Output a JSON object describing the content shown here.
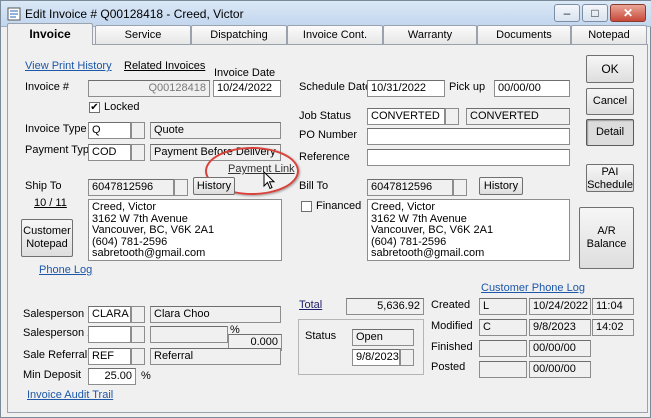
{
  "window": {
    "title": "Edit Invoice # Q00128418  -  Creed, Victor",
    "minimize_glyph": "–",
    "maximize_glyph": "□",
    "close_glyph": "✕"
  },
  "tabs": [
    {
      "label": "Invoice",
      "active": true
    },
    {
      "label": "Service"
    },
    {
      "label": "Dispatching"
    },
    {
      "label": "Invoice Cont."
    },
    {
      "label": "Warranty"
    },
    {
      "label": "Documents"
    },
    {
      "label": "Notepad"
    }
  ],
  "links": {
    "view_print_history": "View Print History",
    "related_invoices": "Related Invoices",
    "payment_link": "Payment Link",
    "phone_log": "Phone Log",
    "customer_phone_log": "Customer Phone Log",
    "invoice_audit_trail": "Invoice Audit Trail",
    "total": "Total"
  },
  "invoice": {
    "number_label": "Invoice #",
    "number": "Q00128418",
    "date_label": "Invoice Date",
    "date": "10/24/2022",
    "locked_label": "Locked",
    "locked": true,
    "type_label": "Invoice Type",
    "type_code": "Q",
    "type_desc": "Quote",
    "payment_type_label": "Payment Type",
    "payment_code": "COD",
    "payment_desc": "Payment Before Delivery"
  },
  "schedule": {
    "schedule_date_label": "Schedule Date",
    "schedule_date": "10/31/2022",
    "pickup_label": "Pick up",
    "pickup": "00/00/00",
    "job_status_label": "Job Status",
    "job_status": "CONVERTED",
    "job_status_desc": "CONVERTED",
    "po_label": "PO Number",
    "po_value": "",
    "reference_label": "Reference",
    "reference_value": ""
  },
  "ship_to": {
    "label": "Ship To",
    "phone": "6047812596",
    "history_button": "History",
    "count": "10 / 11",
    "address": [
      "Creed, Victor",
      "3162 W 7th Avenue",
      "Vancouver, BC, V6K 2A1",
      "(604) 781-2596",
      "sabretooth@gmail.com"
    ]
  },
  "bill_to": {
    "label": "Bill To",
    "phone": "6047812596",
    "history_button": "History",
    "financed_label": "Financed",
    "financed": false,
    "address": [
      "Creed, Victor",
      "3162 W 7th Avenue",
      "Vancouver, BC, V6K 2A1",
      "(604) 781-2596",
      "sabretooth@gmail.com"
    ]
  },
  "buttons": {
    "ok": "OK",
    "cancel": "Cancel",
    "detail": "Detail",
    "pai_schedule": "PAI\nSchedule",
    "ar_balance": "A/R\nBalance",
    "customer_notepad": "Customer\nNotepad"
  },
  "sales": {
    "salesperson1_label": "Salesperson 1",
    "salesperson1_code": "CLARA",
    "salesperson1_name": "Clara Choo",
    "salesperson2_label": "Salesperson 2",
    "salesperson2_code": "",
    "salesperson2_name": "",
    "percent_sign": "%",
    "percent_value": "0.000",
    "sale_referral_label": "Sale Referral",
    "sale_referral_code": "REF",
    "sale_referral_desc": "Referral",
    "min_deposit_label": "Min Deposit",
    "min_deposit": "25.00",
    "min_deposit_unit": "%"
  },
  "totals": {
    "total": "5,636.92",
    "status_label": "Status",
    "status": "Open",
    "status_date": "9/8/2023"
  },
  "audit": {
    "created_label": "Created",
    "created_user": "L",
    "created_date": "10/24/2022",
    "created_time": "11:04",
    "modified_label": "Modified",
    "modified_user": "C",
    "modified_date": "9/8/2023",
    "modified_time": "14:02",
    "finished_label": "Finished",
    "finished_date": "00/00/00",
    "posted_label": "Posted",
    "posted_date": "00/00/00"
  },
  "colors": {
    "link": "#1c57a8",
    "callout": "#d9413a"
  }
}
